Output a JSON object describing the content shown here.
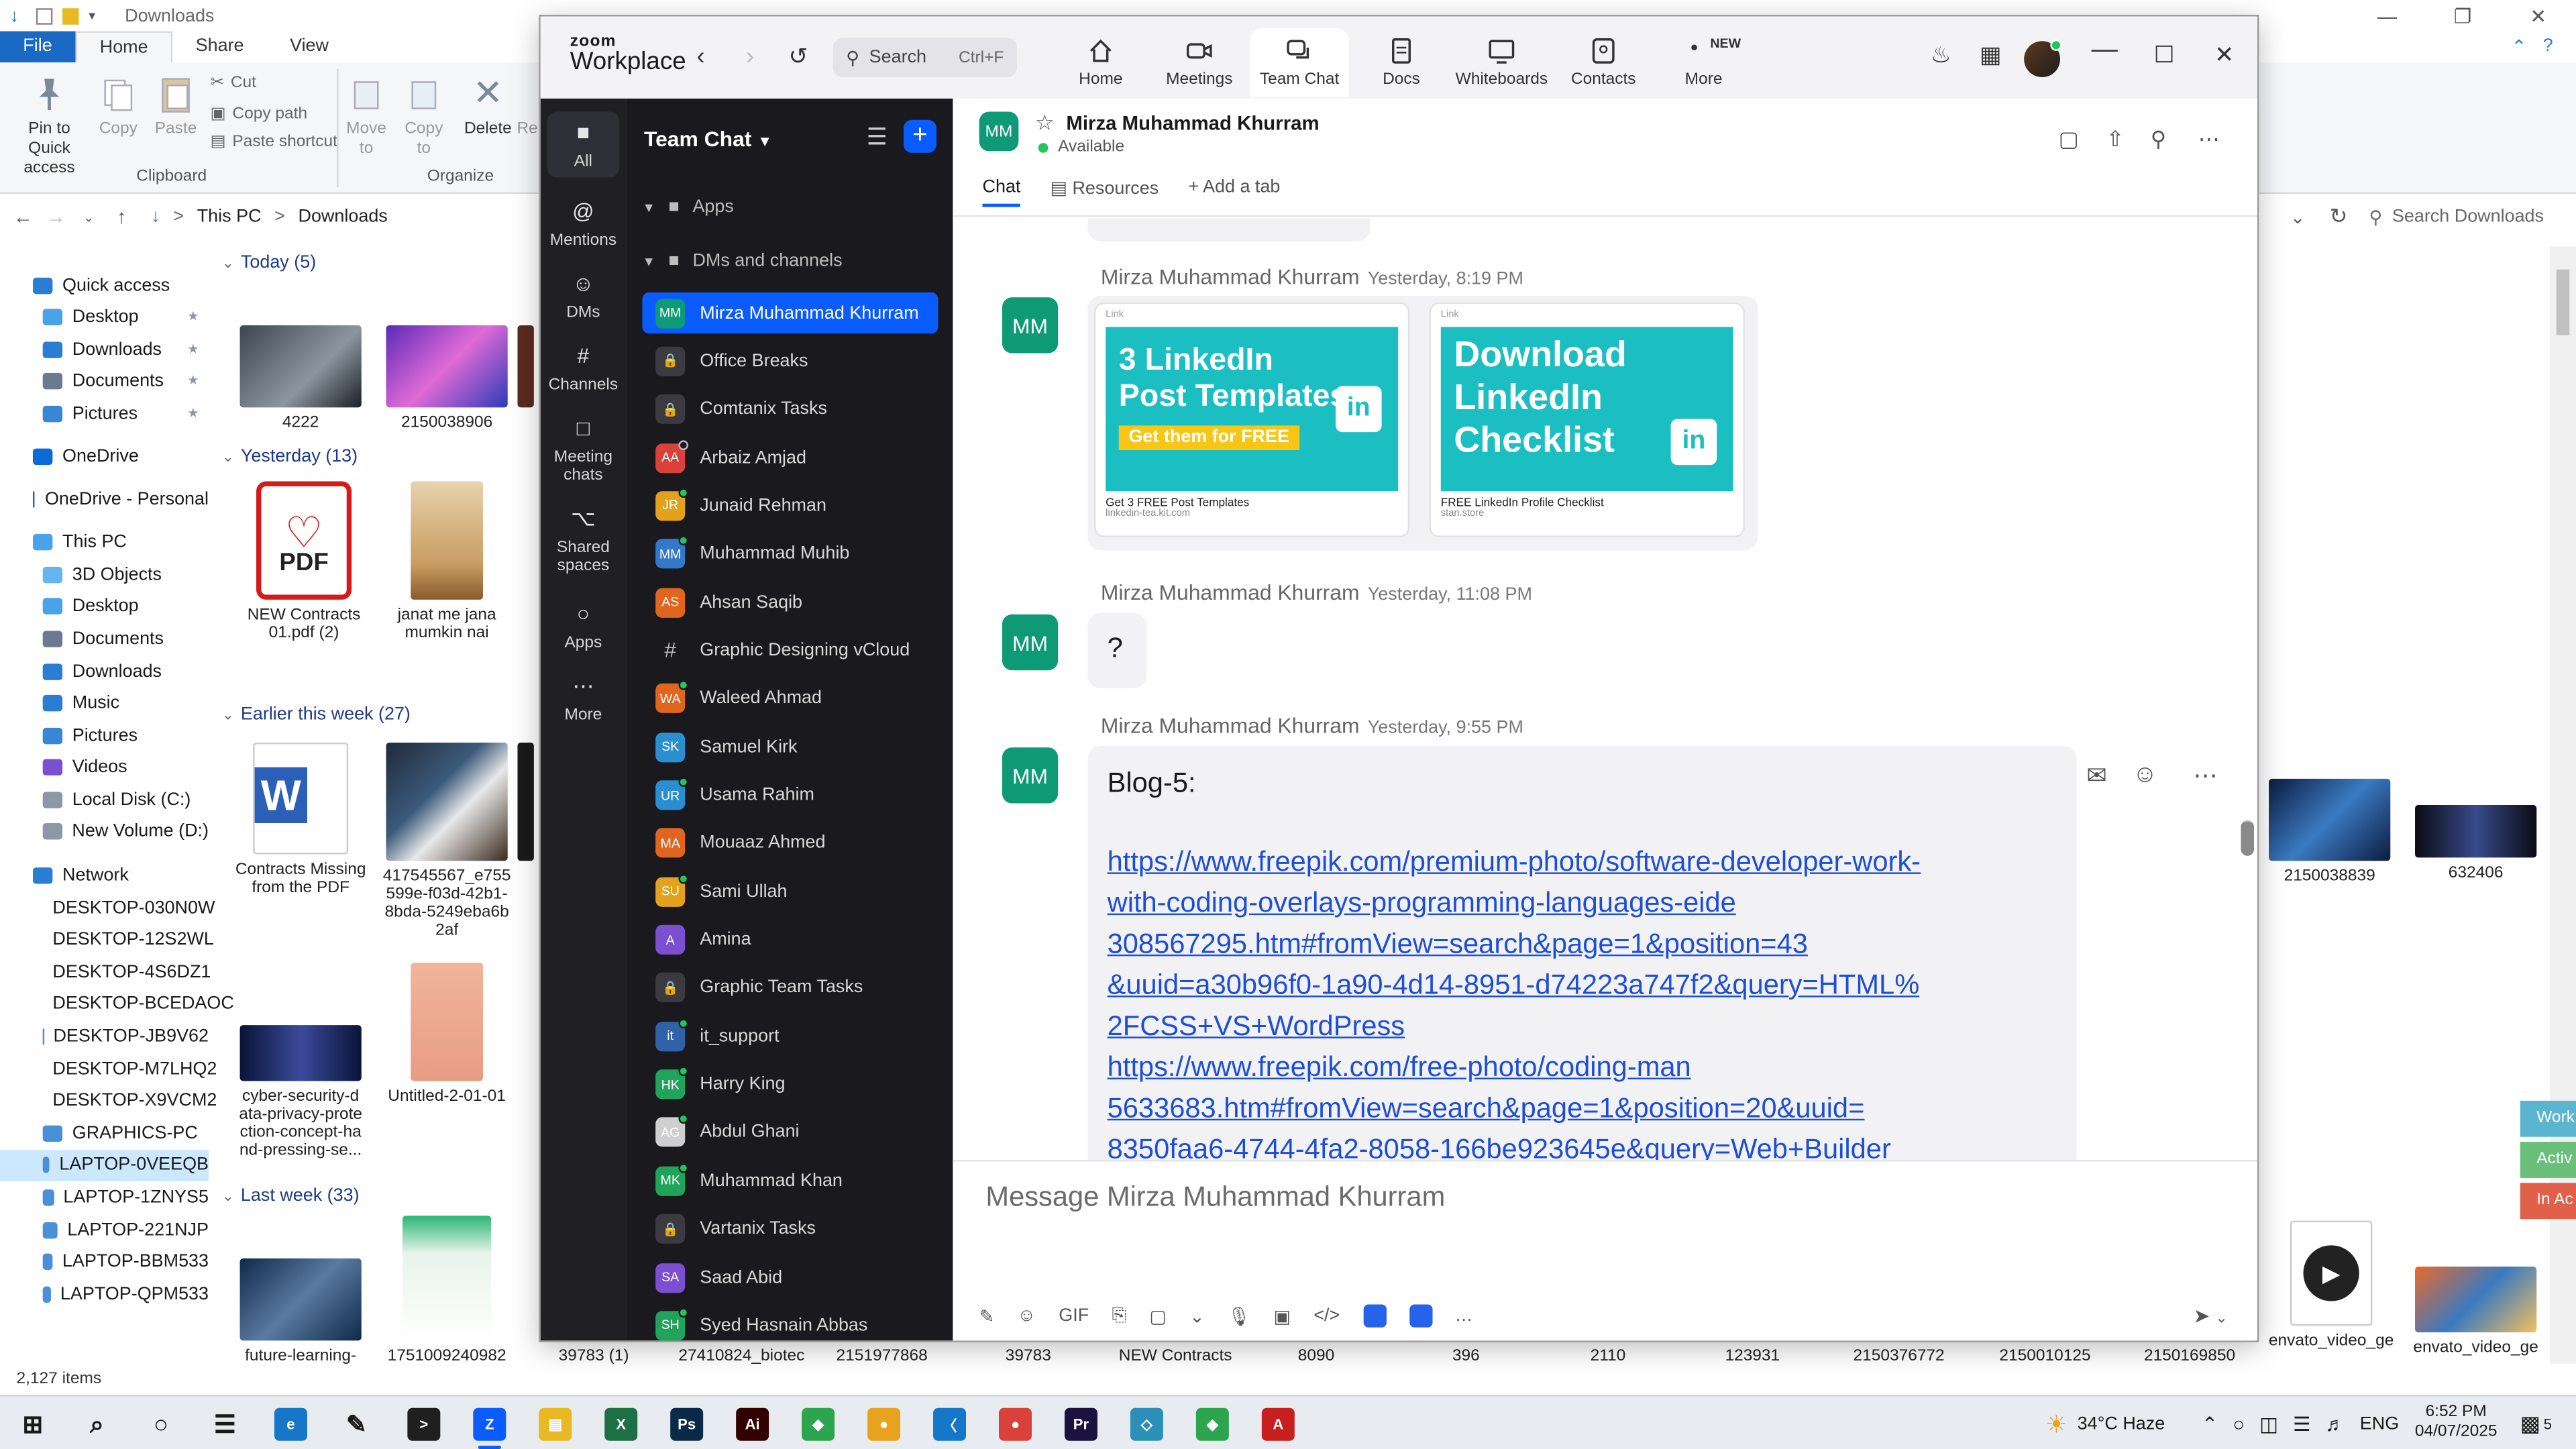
{
  "explorer": {
    "title": "Downloads",
    "tabs": {
      "file": "File",
      "home": "Home",
      "share": "Share",
      "view": "View"
    },
    "ribbon": {
      "pin": "Pin to Quick access",
      "copy": "Copy",
      "paste": "Paste",
      "cut": "Cut",
      "copy_path": "Copy path",
      "paste_shortcut": "Paste shortcut",
      "clipboard_group": "Clipboard",
      "move_to": "Move to",
      "copy_to": "Copy to",
      "delete": "Delete",
      "rename": "Re",
      "organize_group": "Organize"
    },
    "address": {
      "this_pc": "This PC",
      "sep": ">",
      "downloads": "Downloads"
    },
    "search_placeholder": "Search Downloads",
    "nav": [
      {
        "label": "Quick access",
        "color": "#2b7cd3"
      },
      {
        "label": "Desktop",
        "color": "#4aa3e8",
        "pin": "★"
      },
      {
        "label": "Downloads",
        "color": "#2b7cd3",
        "pin": "★"
      },
      {
        "label": "Documents",
        "color": "#6b7a90",
        "pin": "★"
      },
      {
        "label": "Pictures",
        "color": "#3a86d6",
        "pin": "★"
      },
      {
        "label": "OneDrive",
        "color": "#0a6bd6"
      },
      {
        "label": "OneDrive - Personal",
        "color": "#0a6bd6"
      },
      {
        "label": "This PC",
        "color": "#4aa3e8"
      },
      {
        "label": "3D Objects",
        "color": "#65b5f0"
      },
      {
        "label": "Desktop",
        "color": "#4aa3e8"
      },
      {
        "label": "Documents",
        "color": "#6b7a90"
      },
      {
        "label": "Downloads",
        "color": "#2b7cd3"
      },
      {
        "label": "Music",
        "color": "#2b7cd3"
      },
      {
        "label": "Pictures",
        "color": "#3a86d6"
      },
      {
        "label": "Videos",
        "color": "#7a4fd0"
      },
      {
        "label": "Local Disk (C:)",
        "color": "#8a98a8"
      },
      {
        "label": "New Volume (D:)",
        "color": "#8a98a8"
      },
      {
        "label": "Network",
        "color": "#2b7cd3"
      },
      {
        "label": "DESKTOP-030N0W",
        "color": "#4a90d9"
      },
      {
        "label": "DESKTOP-12S2WL",
        "color": "#4a90d9"
      },
      {
        "label": "DESKTOP-4S6DZ1",
        "color": "#4a90d9"
      },
      {
        "label": "DESKTOP-BCEDAOC",
        "color": "#4a90d9"
      },
      {
        "label": "DESKTOP-JB9V62",
        "color": "#4a90d9"
      },
      {
        "label": "DESKTOP-M7LHQ2",
        "color": "#4a90d9"
      },
      {
        "label": "DESKTOP-X9VCM2",
        "color": "#4a90d9"
      },
      {
        "label": "GRAPHICS-PC",
        "color": "#4a90d9"
      },
      {
        "label": "LAPTOP-0VEEQB",
        "color": "#4a90d9"
      },
      {
        "label": "LAPTOP-1ZNYS5",
        "color": "#4a90d9"
      },
      {
        "label": "LAPTOP-221NJP",
        "color": "#4a90d9"
      },
      {
        "label": "LAPTOP-BBM533",
        "color": "#4a90d9"
      },
      {
        "label": "LAPTOP-QPM533",
        "color": "#4a90d9"
      }
    ],
    "groups": {
      "today": "Today (5)",
      "yesterday": "Yesterday (13)",
      "earlier": "Earlier this week (27)",
      "last_week": "Last week (33)"
    },
    "thumbs": [
      {
        "label": "4222"
      },
      {
        "label": "2150038906"
      },
      {
        "label": "NEW Contracts 01.pdf (2)"
      },
      {
        "label": "janat me jana mumkin nai"
      },
      {
        "label": "Contracts Missing from the PDF"
      },
      {
        "label": "417545567_e755 599e-f03d-42b1-8bda-5249eba6b 2af"
      },
      {
        "label": "cyber-security-d ata-privacy-prote ction-concept-ha nd-pressing-se..."
      },
      {
        "label": "Untitled-2-01-01"
      },
      {
        "label": "future-learning-"
      },
      {
        "label": "1751009240982"
      },
      {
        "label": "2150038839"
      },
      {
        "label": "632406"
      },
      {
        "label": "envato_video_ge"
      },
      {
        "label": "envato_video_ge"
      }
    ],
    "bottom_labels": [
      "39783 (1)",
      "27410824_biotec",
      "2151977868",
      "39783",
      "NEW Contracts",
      "8090",
      "396",
      "2110",
      "123931",
      "2150376772",
      "2150010125",
      "2150169850"
    ],
    "status": "2,127 items",
    "pdf_text": "PDF",
    "widgets": [
      "Work",
      "Activ",
      "In Ac"
    ]
  },
  "zoom": {
    "logo_top": "zoom",
    "logo_bottom": "Workplace",
    "search": {
      "label": "Search",
      "shortcut": "Ctrl+F"
    },
    "tabs": [
      {
        "label": "Home"
      },
      {
        "label": "Meetings"
      },
      {
        "label": "Team Chat"
      },
      {
        "label": "Docs"
      },
      {
        "label": "Whiteboards"
      },
      {
        "label": "Contacts"
      },
      {
        "label": "More"
      }
    ],
    "new_badge": "NEW",
    "rail": [
      {
        "label": "All",
        "icon": "■"
      },
      {
        "label": "Mentions",
        "icon": "@"
      },
      {
        "label": "DMs",
        "icon": "☺"
      },
      {
        "label": "Channels",
        "icon": "#"
      },
      {
        "label": "Meeting chats",
        "icon": "□"
      },
      {
        "label": "Shared spaces",
        "icon": "⌥"
      },
      {
        "label": "Apps",
        "icon": "○"
      },
      {
        "label": "More",
        "icon": "⋯"
      }
    ],
    "list": {
      "header": "Team Chat",
      "apps_section": "Apps",
      "dms_section": "DMs and channels",
      "items": [
        {
          "name": "Mirza Muhammad Khurram",
          "initials": "MM",
          "color": "#0e9a77",
          "kind": "dm",
          "presence": "none"
        },
        {
          "name": "Office Breaks",
          "initials": "🔒",
          "color": "#3a3a40",
          "kind": "lock",
          "presence": "none"
        },
        {
          "name": "Comtanix Tasks",
          "initials": "🔒",
          "color": "#3a3a40",
          "kind": "lock",
          "presence": "none"
        },
        {
          "name": "Arbaiz Amjad",
          "initials": "AA",
          "color": "#d9413a",
          "kind": "dm",
          "presence": "off"
        },
        {
          "name": "Junaid Rehman",
          "initials": "JR",
          "color": "#e2a21e",
          "kind": "dm",
          "presence": "on"
        },
        {
          "name": "Muhammad Muhib",
          "initials": "MM",
          "color": "#3479c9",
          "kind": "dm",
          "presence": "on"
        },
        {
          "name": "Ahsan Saqib",
          "initials": "AS",
          "color": "#e0651f",
          "kind": "dm",
          "presence": "none"
        },
        {
          "name": "Graphic Designing vCloud",
          "initials": "#",
          "color": "transparent",
          "kind": "hash",
          "presence": "none"
        },
        {
          "name": "Waleed Ahmad",
          "initials": "WA",
          "color": "#e0651f",
          "kind": "dm",
          "presence": "on"
        },
        {
          "name": "Samuel Kirk",
          "initials": "SK",
          "color": "#2a8fd0",
          "kind": "dm",
          "presence": "none"
        },
        {
          "name": "Usama Rahim",
          "initials": "UR",
          "color": "#2a8fd0",
          "kind": "dm",
          "presence": "on"
        },
        {
          "name": "Mouaaz Ahmed",
          "initials": "MA",
          "color": "#e0651f",
          "kind": "dm",
          "presence": "none"
        },
        {
          "name": "Sami Ullah",
          "initials": "SU",
          "color": "#e2a21e",
          "kind": "dm",
          "presence": "on"
        },
        {
          "name": "Amina",
          "initials": "A",
          "color": "#7b4fd0",
          "kind": "dm",
          "presence": "none"
        },
        {
          "name": "Graphic Team Tasks",
          "initials": "🔒",
          "color": "#3a3a40",
          "kind": "lock",
          "presence": "none"
        },
        {
          "name": "it_support",
          "initials": "it",
          "color": "#3062a8",
          "kind": "dm",
          "presence": "on"
        },
        {
          "name": "Harry King",
          "initials": "HK",
          "color": "#21a35b",
          "kind": "dm",
          "presence": "on"
        },
        {
          "name": "Abdul Ghani",
          "initials": "AG",
          "color": "#cfcfcf",
          "kind": "dm",
          "presence": "on"
        },
        {
          "name": "Muhammad Khan",
          "initials": "MK",
          "color": "#21a35b",
          "kind": "dm",
          "presence": "on"
        },
        {
          "name": "Vartanix Tasks",
          "initials": "🔒",
          "color": "#3a3a40",
          "kind": "lock",
          "presence": "none"
        },
        {
          "name": "Saad Abid",
          "initials": "SA",
          "color": "#7b4fd0",
          "kind": "dm",
          "presence": "none"
        },
        {
          "name": "Syed Hasnain Abbas",
          "initials": "SH",
          "color": "#21a35b",
          "kind": "dm",
          "presence": "on"
        }
      ]
    },
    "chat": {
      "contact": "Mirza Muhammad Khurram",
      "initials": "MM",
      "status": "Available",
      "tabs": {
        "chat": "Chat",
        "resources": "Resources",
        "add": "+ Add a tab"
      },
      "messages": [
        {
          "sender": "Mirza Muhammad Khurram",
          "time": "Yesterday, 8:19 PM"
        },
        {
          "sender": "Mirza Muhammad Khurram",
          "time": "Yesterday, 11:08 PM",
          "text": "?"
        },
        {
          "sender": "Mirza Muhammad Khurram",
          "time": "Yesterday, 9:55 PM",
          "text": "Blog-5:"
        }
      ],
      "cards": [
        {
          "label": "Link",
          "line1": "3 LinkedIn",
          "line2": "Post Templates",
          "cta": "Get them for FREE",
          "caption": "Get 3 FREE Post Templates",
          "domain": "linkedin-tea.kit.com",
          "badge": "in"
        },
        {
          "label": "Link",
          "line1": "Download",
          "line2": "LinkedIn",
          "line3": "Checklist",
          "caption": "FREE LinkedIn Profile Checklist",
          "domain": "stan.store",
          "badge": "in"
        }
      ],
      "links": [
        "https://www.freepik.com/premium-photo/software-developer-work-",
        "with-coding-overlays-programming-languages-eide",
        "308567295.htm#fromView=search&page=1&position=43",
        "&uuid=a30b96f0-1a90-4d14-8951-d74223a747f2&query=HTML%",
        "2FCSS+VS+WordPress",
        "https://www.freepik.com/free-photo/coding-man",
        "5633683.htm#fromView=search&page=1&position=20&uuid=",
        "8350faa6-4744-4fa2-8058-166be923645e&query=Web+Builder"
      ],
      "placeholder": "Message Mirza Muhammad Khurram",
      "tools": [
        "✎",
        "☺",
        "GIF",
        "⎘",
        "▢",
        "⌄",
        "🎙",
        "▣",
        "</>",
        "…"
      ]
    }
  },
  "taskbar": {
    "weather": "34°C Haze",
    "lang": "ENG",
    "time": "6:52 PM",
    "date": "04/07/2025",
    "notif_count": "5",
    "apps": [
      {
        "name": "start",
        "label": "⊞",
        "color": "#1a1a1a"
      },
      {
        "name": "search",
        "label": "⌕",
        "color": "#1a1a1a"
      },
      {
        "name": "cortana",
        "label": "○",
        "color": "#1a1a1a"
      },
      {
        "name": "taskview",
        "label": "☰",
        "color": "#1a1a1a"
      },
      {
        "name": "edge",
        "label": "e",
        "color": "#1677c8"
      },
      {
        "name": "pen",
        "label": "✎",
        "color": "#1a1a1a"
      },
      {
        "name": "terminal",
        "label": ">",
        "color": "#1f1f1f"
      },
      {
        "name": "zoom",
        "label": "Z",
        "color": "#0b5cff"
      },
      {
        "name": "files",
        "label": "▤",
        "color": "#e8b923"
      },
      {
        "name": "excel",
        "label": "X",
        "color": "#1d7044"
      },
      {
        "name": "photoshop",
        "label": "Ps",
        "color": "#0b2a4a"
      },
      {
        "name": "illustrator",
        "label": "Ai",
        "color": "#330000"
      },
      {
        "name": "gcs1",
        "label": "◆",
        "color": "#2da44e"
      },
      {
        "name": "chrome",
        "label": "●",
        "color": "#e8a21e"
      },
      {
        "name": "vscode",
        "label": "〈",
        "color": "#1677c8"
      },
      {
        "name": "chrome2",
        "label": "●",
        "color": "#d9413a"
      },
      {
        "name": "premiere",
        "label": "Pr",
        "color": "#1b1240"
      },
      {
        "name": "app2",
        "label": "◇",
        "color": "#2b8fb8"
      },
      {
        "name": "gcs2",
        "label": "◆",
        "color": "#2da44e"
      },
      {
        "name": "acrobat",
        "label": "A",
        "color": "#c81e1e"
      }
    ]
  }
}
